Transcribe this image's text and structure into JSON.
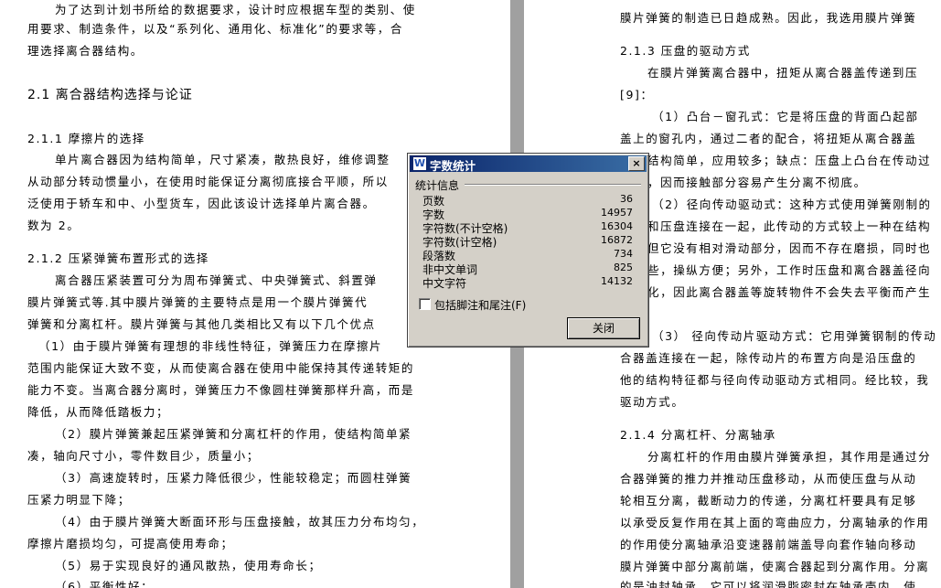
{
  "left_page": {
    "lines": [
      "为了达到计划书所给的数据要求，设计时应根据车型的类别、使",
      "用要求、制造条件，以及“系列化、通用化、标准化”的要求等，合",
      "理选择离合器结构。",
      "2.1  离合器结构选择与论证",
      "2.1.1   摩擦片的选择",
      "单片离合器因为结构简单，尺寸紧凑，散热良好，维修调整",
      "从动部分转动惯量小，在使用时能保证分离彻底接合平顺，所以",
      "泛使用于轿车和中、小型货车，因此该设计选择单片离合器。",
      "数为 2。",
      "2.1.2   压紧弹簧布置形式的选择",
      "离合器压紧装置可分为周布弹簧式、中央弹簧式、斜置弹",
      "膜片弹簧式等.其中膜片弹簧的主要特点是用一个膜片弹簧代",
      "弹簧和分离杠杆。膜片弹簧与其他几类相比又有以下几个优点",
      "（1）由于膜片弹簧有理想的非线性特征，弹簧压力在摩擦片",
      "范围内能保证大致不变，从而使离合器在使用中能保持其传递转矩的",
      "能力不变。当离合器分离时，弹簧压力不像圆柱弹簧那样升高，而是",
      "降低，从而降低踏板力；",
      "（2）膜片弹簧兼起压紧弹簧和分离杠杆的作用，使结构简单紧",
      "凑，轴向尺寸小，零件数目少，质量小；",
      "（3）高速旋转时，压紧力降低很少，性能较稳定；而圆柱弹簧",
      "压紧力明显下降；",
      "（4）由于膜片弹簧大断面环形与压盘接触，故其压力分布均匀，",
      "摩擦片磨损均匀，可提高使用寿命；",
      "（5）易于实现良好的通风散热，使用寿命长；",
      "（6）平衡性好；"
    ]
  },
  "right_page": {
    "lines": [
      "膜片弹簧的制造已日趋成熟。因此，我选用膜片弹簧",
      "2.1.3   压盘的驱动方式",
      "在膜片弹簧离合器中，扭矩从离合器盖传递到压",
      "[9]：",
      "（1）凸台－窗孔式：它是将压盘的背面凸起部",
      "盖上的窗孔内，通过二者的配合，将扭矩从离合器盖",
      "结构简单，应用较多；缺点：压盘上凸台在传动过",
      "，因而接触部分容易产生分离不彻底。",
      "（2）径向传动驱动式：这种方式使用弹簧刚制的",
      "和压盘连接在一起，此传动的方式较上一种在结构",
      "但它没有相对滑动部分，因而不存在磨损，同时也",
      "些，操纵方便；另外，工作时压盘和离合器盖径向",
      "化，因此离合器盖等旋转物件不会失去平衡而产生",
      "（3） 径向传动片驱动方式：它用弹簧钢制的传动",
      "合器盖连接在一起，除传动片的布置方向是沿压盘的",
      "他的结构特征都与径向传动驱动方式相同。经比较，我",
      "驱动方式。",
      "2.1.4  分离杠杆、分离轴承",
      "分离杠杆的作用由膜片弹簧承担，其作用是通过分",
      "合器弹簧的推力并推动压盘移动，从而使压盘与从动",
      "轮相互分离，截断动力的传递，分离杠杆要具有足够",
      "以承受反复作用在其上面的弯曲应力，分离轴承的作用",
      "的作用使分离轴承沿变速器前端盖导向套作轴向移动",
      "膜片弹簧中部分离前端，使离合器起到分离作用。分离",
      "的是油封轴承，它可以将润滑脂密封在轴承壳内，使"
    ]
  },
  "dialog": {
    "title": "字数统计",
    "app_icon_letter": "W",
    "close_glyph": "×",
    "group_label": "统计信息",
    "stats": [
      {
        "label": "页数",
        "value": "36"
      },
      {
        "label": "字数",
        "value": "14957"
      },
      {
        "label": "字符数(不计空格)",
        "value": "16304"
      },
      {
        "label": "字符数(计空格)",
        "value": "16872"
      },
      {
        "label": "段落数",
        "value": "734"
      },
      {
        "label": "非中文单词",
        "value": "825"
      },
      {
        "label": "中文字符",
        "value": "14132"
      }
    ],
    "checkbox_label": "包括脚注和尾注(F)",
    "checkbox_checked": false,
    "close_button_label": "关闭"
  }
}
